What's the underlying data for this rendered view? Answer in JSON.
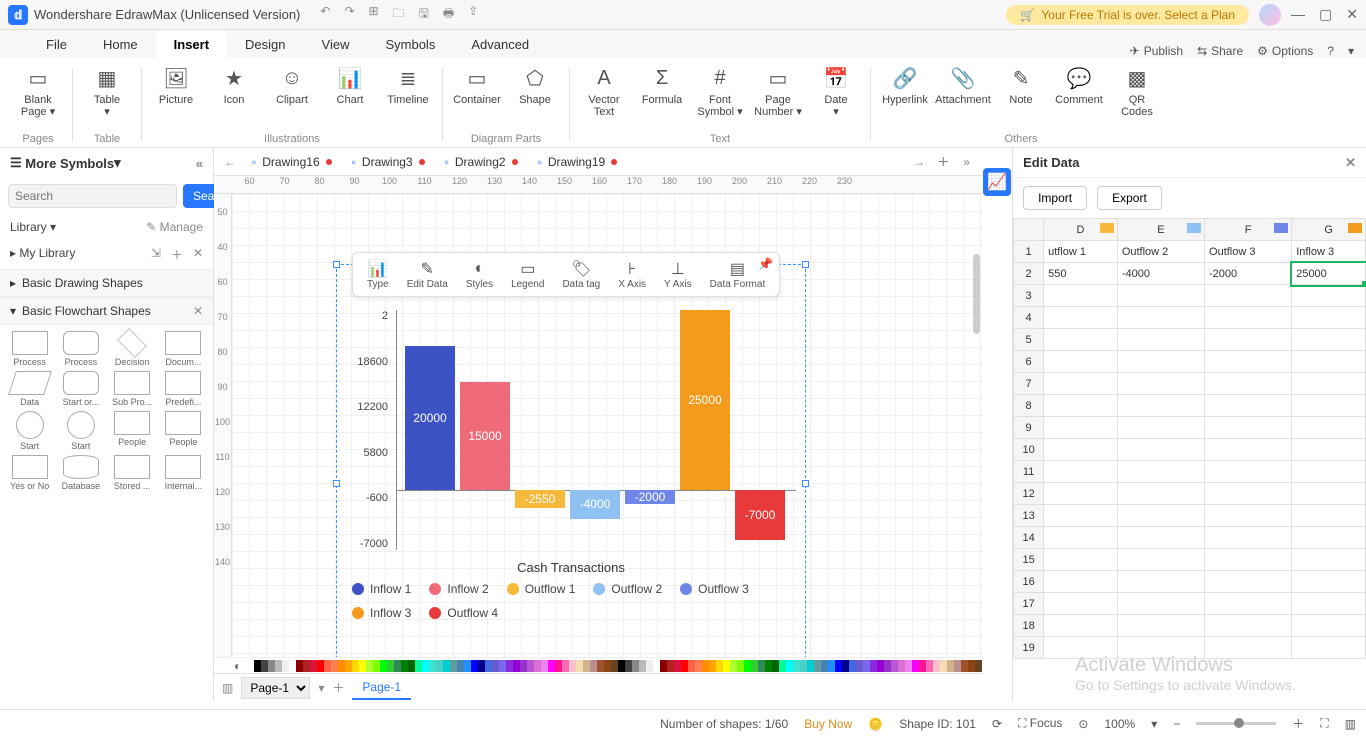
{
  "app": {
    "title": "Wondershare EdrawMax (Unlicensed Version)",
    "trial": "Your Free Trial is over. Select a Plan"
  },
  "menu": {
    "tabs": [
      "File",
      "Home",
      "Insert",
      "Design",
      "View",
      "Symbols",
      "Advanced"
    ],
    "active": "Insert",
    "right": {
      "publish": "Publish",
      "share": "Share",
      "options": "Options"
    }
  },
  "ribbon": {
    "groups": [
      {
        "label": "Pages",
        "items": [
          {
            "icon": "▭",
            "label": "Blank\nPage ▾"
          }
        ]
      },
      {
        "label": "Table",
        "items": [
          {
            "icon": "▦",
            "label": "Table\n▾"
          }
        ]
      },
      {
        "label": "Illustrations",
        "items": [
          {
            "icon": "🖼",
            "label": "Picture"
          },
          {
            "icon": "★",
            "label": "Icon"
          },
          {
            "icon": "☺",
            "label": "Clipart"
          },
          {
            "icon": "📊",
            "label": "Chart"
          },
          {
            "icon": "≣",
            "label": "Timeline"
          }
        ]
      },
      {
        "label": "Diagram Parts",
        "items": [
          {
            "icon": "▭",
            "label": "Container"
          },
          {
            "icon": "⬠",
            "label": "Shape"
          }
        ]
      },
      {
        "label": "Text",
        "items": [
          {
            "icon": "A",
            "label": "Vector\nText"
          },
          {
            "icon": "Σ",
            "label": "Formula"
          },
          {
            "icon": "#",
            "label": "Font\nSymbol ▾"
          },
          {
            "icon": "▭",
            "label": "Page\nNumber ▾"
          },
          {
            "icon": "📅",
            "label": "Date\n▾"
          }
        ]
      },
      {
        "label": "Others",
        "items": [
          {
            "icon": "🔗",
            "label": "Hyperlink"
          },
          {
            "icon": "📎",
            "label": "Attachment"
          },
          {
            "icon": "✎",
            "label": "Note"
          },
          {
            "icon": "💬",
            "label": "Comment"
          },
          {
            "icon": "▩",
            "label": "QR\nCodes"
          }
        ]
      }
    ]
  },
  "leftpanel": {
    "more": "More Symbols",
    "search_ph": "Search",
    "search_btn": "Search",
    "library": "Library ▾",
    "manage": "✎ Manage",
    "mylib": "My Library",
    "sec1": "Basic Drawing Shapes",
    "sec2": "Basic Flowchart Shapes",
    "shapes": [
      "Process",
      "Process",
      "Decision",
      "Docum...",
      "Data",
      "Start or...",
      "Sub Pro...",
      "Predefi...",
      "Start",
      "Start",
      "People",
      "People",
      "Yes or No",
      "Database",
      "Stored ...",
      "Internal..."
    ]
  },
  "doctabs": {
    "tabs": [
      {
        "name": "Drawing16",
        "dirty": true
      },
      {
        "name": "Drawing3",
        "dirty": true
      },
      {
        "name": "Drawing2",
        "dirty": true
      },
      {
        "name": "Drawing19",
        "dirty": true
      }
    ]
  },
  "charttoolbar": [
    "Type",
    "Edit Data",
    "Styles",
    "Legend",
    "Data tag",
    "X Axis",
    "Y Axis",
    "Data Format"
  ],
  "chart_data": {
    "type": "bar",
    "title": "Cash Transactions",
    "ylabel": "",
    "yticks": [
      "2",
      "18600",
      "12200",
      "5800",
      "-600",
      "-7000"
    ],
    "series": [
      {
        "name": "Inflow 1",
        "color": "#3d52c4",
        "value": 20000
      },
      {
        "name": "Inflow 2",
        "color": "#ef6b7a",
        "value": 15000
      },
      {
        "name": "Outflow 1",
        "color": "#f6b93a",
        "value": -2550
      },
      {
        "name": "Outflow 2",
        "color": "#8fc1f2",
        "value": -4000
      },
      {
        "name": "Outflow 3",
        "color": "#6f87e8",
        "value": -2000
      },
      {
        "name": "Inflow 3",
        "color": "#f59b1c",
        "value": 25000
      },
      {
        "name": "Outflow 4",
        "color": "#e83a3a",
        "value": -7000
      }
    ]
  },
  "rightpanel": {
    "title": "Edit Data",
    "import": "Import",
    "export": "Export",
    "col_letters": [
      "D",
      "E",
      "F",
      "G"
    ],
    "col_colors": [
      "#f6b93a",
      "#8fc1f2",
      "#6f87e8",
      "#f59b1c"
    ],
    "row1": [
      "utflow 1",
      "Outflow 2",
      "Outflow 3",
      "Inflow 3"
    ],
    "row2": [
      "550",
      "-4000",
      "-2000",
      "25000"
    ],
    "active_cell": "G2"
  },
  "status": {
    "shapes": "Number of shapes: 1/60",
    "buy": "Buy Now",
    "shapeid": "Shape ID: 101",
    "focus": "Focus",
    "zoom": "100%",
    "page": "Page-1",
    "ptab": "Page-1"
  },
  "ruler_h": [
    "60",
    "70",
    "80",
    "90",
    "100",
    "110",
    "120",
    "130",
    "140",
    "150",
    "160",
    "170",
    "180",
    "190",
    "200",
    "210",
    "220",
    "230"
  ],
  "ruler_v": [
    "50",
    "40",
    "60",
    "70",
    "80",
    "90",
    "100",
    "110",
    "120",
    "130",
    "140"
  ],
  "watermark": {
    "l1": "Activate Windows",
    "l2": "Go to Settings to activate Windows."
  }
}
